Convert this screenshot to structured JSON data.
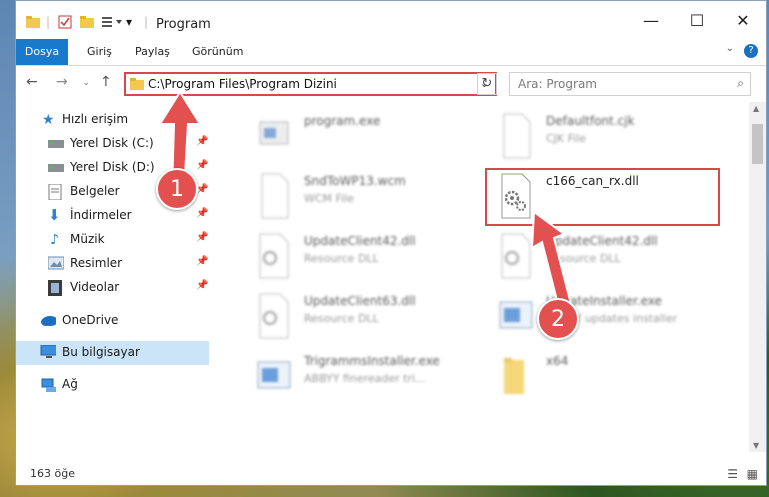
{
  "window": {
    "title": "Program"
  },
  "ribbon": {
    "tabs": [
      "Dosya",
      "Giriş",
      "Paylaş",
      "Görünüm"
    ],
    "help": "?"
  },
  "address": {
    "path": "C:\\Program Files\\Program Dizini"
  },
  "search": {
    "placeholder": "Ara: Program"
  },
  "sidebar": {
    "items": [
      {
        "label": "Hızlı erişim"
      },
      {
        "label": "Yerel Disk (C:)"
      },
      {
        "label": "Yerel Disk (D:)"
      },
      {
        "label": "Belgeler"
      },
      {
        "label": "İndirmeler"
      },
      {
        "label": "Müzik"
      },
      {
        "label": "Resimler"
      },
      {
        "label": "Videolar"
      },
      {
        "label": "OneDrive"
      },
      {
        "label": "Bu bilgisayar"
      },
      {
        "label": "Ağ"
      }
    ]
  },
  "files": [
    {
      "name": "program.exe",
      "type": ""
    },
    {
      "name": "Defaultfont.cjk",
      "type": "CJK File"
    },
    {
      "name": "SndToWP13.wcm",
      "type": "WCM File"
    },
    {
      "name": "c166_can_rx.dll",
      "type": ""
    },
    {
      "name": "UpdateClient42.dll",
      "type": "Resource DLL"
    },
    {
      "name": "UpdateClient42.dll",
      "type": "Resource DLL"
    },
    {
      "name": "UpdateClient63.dll",
      "type": "Resource DLL"
    },
    {
      "name": "UpdateInstaller.exe",
      "type": "ABBYY updates installer"
    },
    {
      "name": "TrigrammsInstaller.exe",
      "type": "ABBYY finereader tri..."
    },
    {
      "name": "x64",
      "type": ""
    }
  ],
  "status": {
    "count": "163 öğe"
  },
  "annotations": {
    "step1": "1",
    "step2": "2",
    "color": "#e35050"
  }
}
